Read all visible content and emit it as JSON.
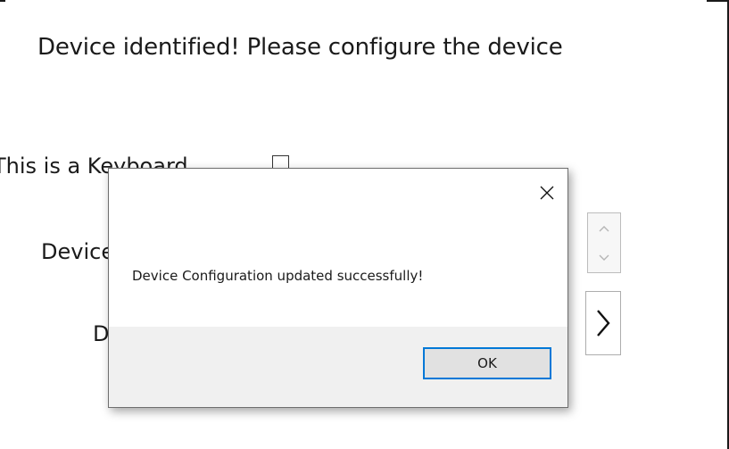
{
  "background_window": {
    "heading": "Device identified! Please configure the device",
    "keyboard_label": "This is a Keyboard",
    "device_label": "Device",
    "d_label": "D"
  },
  "icons": {
    "spinner_up": "chevron-up-icon",
    "spinner_down": "chevron-down-icon",
    "next": "chevron-right-icon",
    "close": "close-icon"
  },
  "dialog": {
    "message": "Device Configuration updated successfully!",
    "ok_label": "OK"
  },
  "colors": {
    "ok_border": "#0078d7",
    "dialog_footer": "#f0f0f0",
    "button_face": "#e1e1e1"
  }
}
